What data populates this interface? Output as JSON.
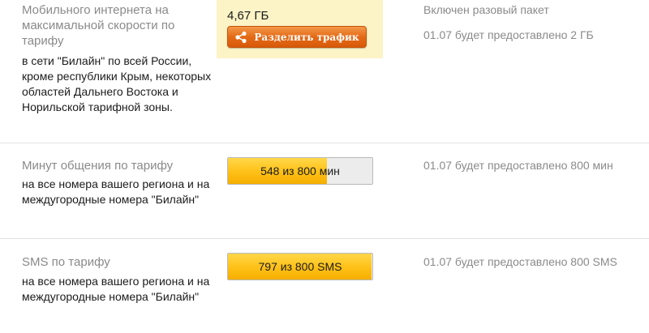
{
  "internet": {
    "title": "Мобильного интернета на максимальной скорости по тарифу",
    "description": "в сети \"Билайн\" по всей России, кроме республики Крым, некоторых областей Дальнего Востока и Норильской тарифной зоны.",
    "amount": "4,67 ГБ",
    "share_button": "Разделить трафик",
    "status_line1": "Включен разовый пакет",
    "status_line2": "01.07 будет предоставлено 2 ГБ"
  },
  "minutes": {
    "title": "Минут общения по тарифу",
    "description": "на все номера вашего региона и на междугородные номера \"Билайн\"",
    "used": 548,
    "total": 800,
    "bar_label": "548 из 800 мин",
    "status": "01.07 будет предоставлено 800 мин"
  },
  "sms": {
    "title": "SMS по тарифу",
    "description": "на все номера вашего региона и на междугородные номера \"Билайн\"",
    "used": 797,
    "total": 800,
    "bar_label": "797 из 800 SMS",
    "status": "01.07 будет предоставлено 800 SMS"
  },
  "colors": {
    "bar_fill": "#ffc21a",
    "button": "#e46a17",
    "highlight_box": "#fcf3c6"
  }
}
